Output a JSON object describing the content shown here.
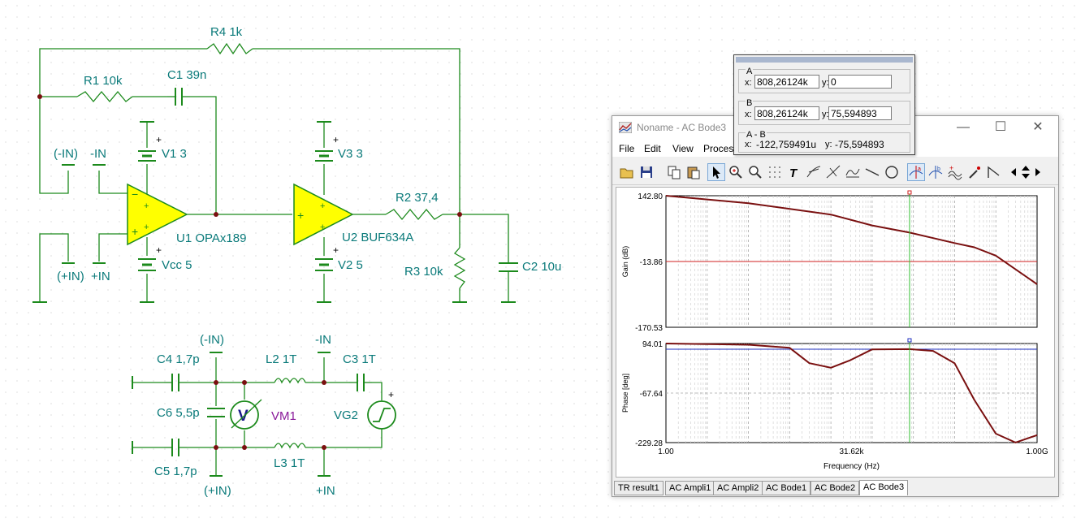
{
  "schematic": {
    "components": {
      "r4": "R4 1k",
      "r1": "R1 10k",
      "c1": "C1 39n",
      "v1": "V1 3",
      "v3": "V3 3",
      "u1": "U1 OPAx189",
      "u2": "U2 BUF634A",
      "r2": "R2 37,4",
      "r3": "R3 10k",
      "c2": "C2 10u",
      "vcc": "Vcc 5",
      "v2": "V2 5",
      "c4": "C4 1,7p",
      "c6": "C6 5,5p",
      "c5": "C5 1,7p",
      "l2": "L2 1T",
      "l3": "L3 1T",
      "c3": "C3 1T",
      "vm1": "VM1",
      "vg2": "VG2",
      "vm_symbol": "V"
    },
    "ports": {
      "nin_paren": "(-IN)",
      "nin": "-IN",
      "pin_paren": "(+IN)",
      "pin": "+IN",
      "b_nin_paren": "(-IN)",
      "b_nin": "-IN",
      "b_pin_paren": "(+IN)",
      "b_pin": "+IN"
    },
    "colors": {
      "wire": "#1c8a1c",
      "label": "#0a7a7a",
      "opamp_fill": "#ffff00",
      "node": "#7a1010"
    }
  },
  "bode": {
    "title": "Noname - AC Bode3",
    "menu": [
      "File",
      "Edit",
      "View",
      "Process"
    ],
    "tabs": [
      "TR result1",
      "AC Ampli1",
      "AC Ampli2",
      "AC Bode1",
      "AC Bode2",
      "AC Bode3"
    ],
    "active_tab": "AC Bode3",
    "toolbar_icons": [
      "open-icon",
      "save-icon",
      "copy-icon",
      "paste-icon",
      "pointer-icon",
      "zoom-in-icon",
      "zoom-100-icon",
      "grid-icon",
      "text-icon",
      "tangent-icon",
      "slope-icon",
      "curve-icon",
      "line-icon",
      "circle-icon",
      "cursor-a-icon",
      "cursor-b-icon",
      "add-curve-icon",
      "probe-icon",
      "marker-icon",
      "left-arrow-icon",
      "up-down-icon",
      "right-arrow-icon"
    ]
  },
  "chart_data": [
    {
      "type": "line",
      "ylabel": "Gain (dB)",
      "x_scale": "log",
      "xlim": [
        1,
        1000000000
      ],
      "ylim": [
        -170.53,
        142.8
      ],
      "y_ticks": [
        "142.80",
        "-13.86",
        "-170.53"
      ],
      "grid": true,
      "series": [
        {
          "color": "#7a1010",
          "x": [
            1,
            100,
            10000,
            100000,
            808261.24,
            10000000,
            30000000,
            100000000,
            1000000000
          ],
          "y": [
            142.8,
            125,
            98,
            72,
            55,
            30,
            20,
            0,
            -68
          ]
        }
      ],
      "reference_level": -13.86,
      "cursor_x": 808261.24
    },
    {
      "type": "line",
      "ylabel": "Phase [deg]",
      "xlabel": "Frequency (Hz)",
      "x_scale": "log",
      "xlim": [
        1,
        1000000000
      ],
      "ylim": [
        -229.28,
        94.01
      ],
      "y_ticks": [
        "94.01",
        "-67.64",
        "-229.28"
      ],
      "x_ticks": [
        "1.00",
        "31.62k",
        "1.00G"
      ],
      "grid": true,
      "series": [
        {
          "color": "#7a1010",
          "x": [
            1,
            100,
            1000,
            3000,
            10000,
            30000,
            100000,
            808261.24,
            3000000,
            10000000,
            30000000,
            100000000,
            300000000,
            1000000000
          ],
          "y": [
            94,
            90,
            80,
            30,
            15,
            40,
            75,
            75.6,
            70,
            30,
            -90,
            -200,
            -229,
            -205
          ]
        }
      ],
      "reference_level": 75.59,
      "cursor_x": 808261.24
    }
  ],
  "cursor": {
    "a": {
      "title": "A",
      "x_label": "x:",
      "x": "808,26124k",
      "y_label": "y:",
      "y": "0"
    },
    "b": {
      "title": "B",
      "x_label": "x:",
      "x": "808,26124k",
      "y_label": "y:",
      "y": "75,594893"
    },
    "ab": {
      "title": "A - B",
      "x_label": "x:",
      "x": "-122,759491u",
      "y_label": "y:",
      "y": "-75,594893"
    }
  }
}
